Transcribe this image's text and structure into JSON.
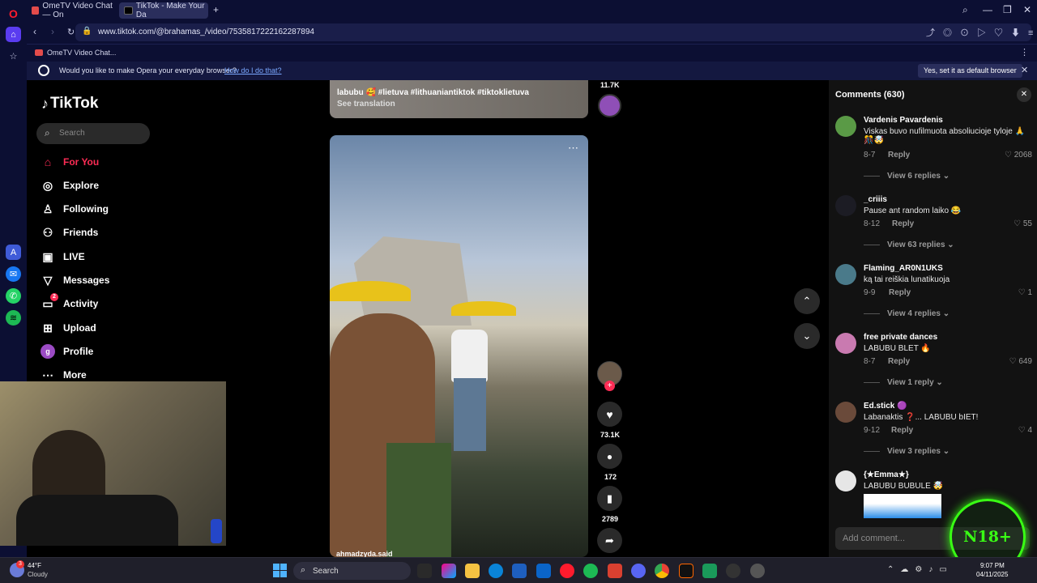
{
  "browser": {
    "tabs": [
      {
        "title": "OmeTV Video Chat — On"
      },
      {
        "title": "TikTok - Make Your Da"
      }
    ],
    "url": "www.tiktok.com/@brahamas_/video/7535817222162287894",
    "bookmark": "OmeTV Video Chat...",
    "notification": {
      "text": "Would you like to make Opera your everyday browser?",
      "link": "How do I do that?",
      "button": "Yes, set it as default browser"
    }
  },
  "tiktok": {
    "logo": "TikTok",
    "search_placeholder": "Search",
    "nav": [
      {
        "label": "For You",
        "icon": "home-icon",
        "active": true
      },
      {
        "label": "Explore",
        "icon": "compass-icon"
      },
      {
        "label": "Following",
        "icon": "following-icon"
      },
      {
        "label": "Friends",
        "icon": "friends-icon"
      },
      {
        "label": "LIVE",
        "icon": "live-icon"
      },
      {
        "label": "Messages",
        "icon": "messages-icon"
      },
      {
        "label": "Activity",
        "icon": "activity-icon",
        "badge": "2"
      },
      {
        "label": "Upload",
        "icon": "upload-icon"
      },
      {
        "label": "Profile",
        "icon": "profile-icon",
        "avatar_letter": "g"
      },
      {
        "label": "More",
        "icon": "more-icon"
      }
    ],
    "prev_video": {
      "caption": "labubu 🥰 #lietuva #lithuaniantiktok #tiktoklietuva",
      "translation": "See translation",
      "likes": "11.7K"
    },
    "video": {
      "author": "ahmadzyda.said",
      "likes": "73.1K",
      "comments": "172",
      "saves": "2789"
    }
  },
  "comments_panel": {
    "title": "Comments (630)",
    "placeholder": "Add comment...",
    "items": [
      {
        "user": "Vardenis Pavardenis",
        "text": "Viskas buvo nufilmuota absoliucioje tyloje 🙏🎊🤯",
        "date": "8-7",
        "reply": "Reply",
        "likes": "2068",
        "view": "View 6 replies"
      },
      {
        "user": "_criiis",
        "text": "Pause ant random laiko 😂",
        "date": "8-12",
        "reply": "Reply",
        "likes": "55",
        "view": "View 63 replies"
      },
      {
        "user": "Flaming_AR0N1UKS",
        "text": "ką tai reiškia lunatikuoja",
        "date": "9-9",
        "reply": "Reply",
        "likes": "1",
        "view": "View 4 replies"
      },
      {
        "user": "free private dances",
        "text": "LABUBU BLET 🔥",
        "date": "8-7",
        "reply": "Reply",
        "likes": "649",
        "view": "View 1 reply"
      },
      {
        "user": "Ed.stick 🟣",
        "text": "Labanaktis ❓... LABUBU bIET!",
        "date": "9-12",
        "reply": "Reply",
        "likes": "4",
        "view": "View 3 replies"
      },
      {
        "user": "{★Emma★}",
        "text": "LABUBU BUBULE 🤯",
        "date": "",
        "reply": "",
        "likes": "",
        "view": ""
      }
    ]
  },
  "overlay": {
    "badge": "N18+"
  },
  "taskbar": {
    "weather_temp": "44°F",
    "weather_desc": "Cloudy",
    "weather_badge": "3",
    "search": "Search",
    "time": "9:07 PM",
    "date": "04/11/2025"
  }
}
